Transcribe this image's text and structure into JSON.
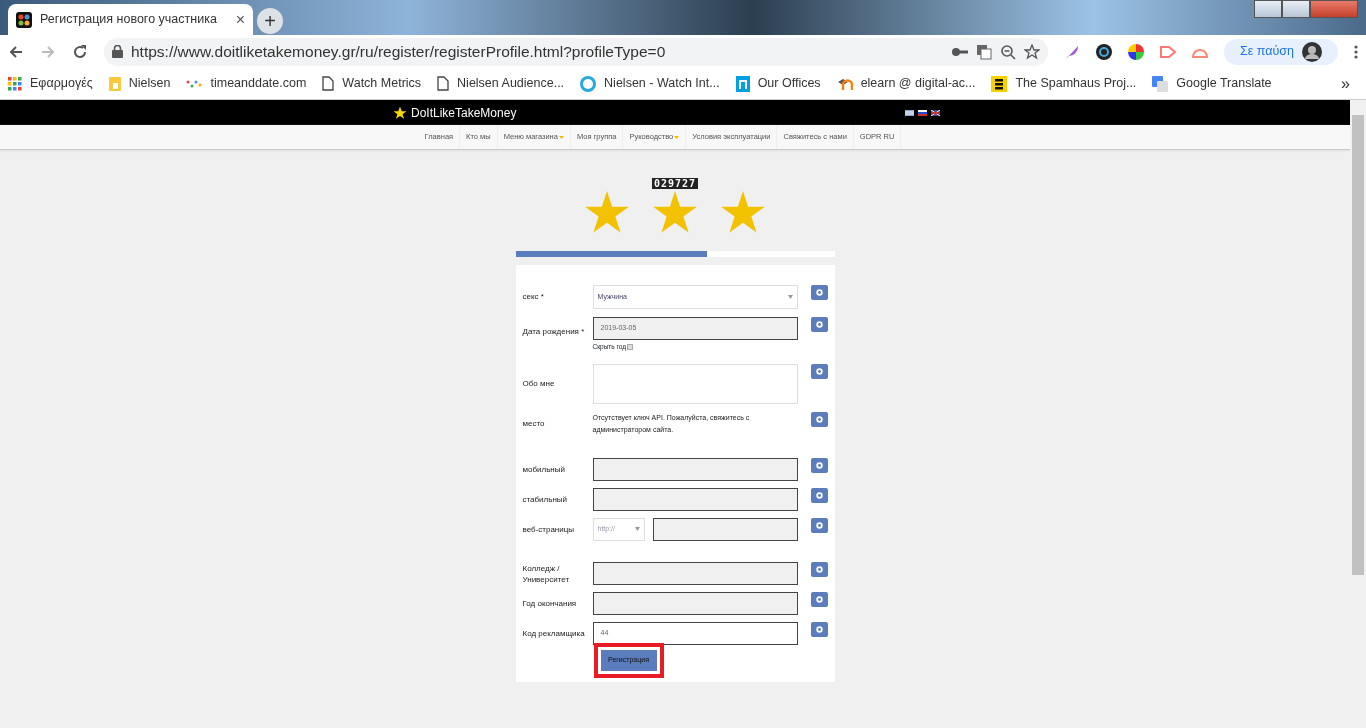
{
  "browser": {
    "tab": {
      "title": "Регистрация нового участника",
      "close": "×"
    },
    "new_tab": "+",
    "url": "https://www.doitliketakemoney.gr/ru/register/registerProfile.html?profileType=0",
    "profile": "Σε παύση",
    "bookmarks": [
      {
        "label": "Εφαρμογές",
        "kind": "apps"
      },
      {
        "label": "Nielsen",
        "kind": "folder"
      },
      {
        "label": "timeanddate.com",
        "kind": "dots"
      },
      {
        "label": "Watch Metrics",
        "kind": "page"
      },
      {
        "label": "Nielsen Audience...",
        "kind": "page"
      },
      {
        "label": "Nielsen - Watch Int...",
        "kind": "circle"
      },
      {
        "label": "Our Offices",
        "kind": "n"
      },
      {
        "label": "elearn @ digital-ac...",
        "kind": "hat"
      },
      {
        "label": "The Spamhaus Proj...",
        "kind": "s"
      },
      {
        "label": "Google Translate",
        "kind": "translate"
      }
    ],
    "more": "»"
  },
  "site": {
    "brand": "DoItLikeTakeMoney",
    "nav": [
      {
        "label": "Главная",
        "dropdown": false
      },
      {
        "label": "Кто мы",
        "dropdown": false
      },
      {
        "label": "Меню магазина",
        "dropdown": true
      },
      {
        "label": "Моя группа",
        "dropdown": false
      },
      {
        "label": "Руководство",
        "dropdown": true
      },
      {
        "label": "Условия эксплуатации",
        "dropdown": false
      },
      {
        "label": "Свяжитесь с нами",
        "dropdown": false
      },
      {
        "label": "GDPR RU",
        "dropdown": false
      }
    ],
    "counter": "029727",
    "stars": 3,
    "progress": {
      "level": 0.6
    },
    "form": {
      "rows": [
        {
          "kind": "select",
          "label": "секс *",
          "value": "Мужчина"
        },
        {
          "kind": "date",
          "label": "Дата рождения *",
          "value": "2019-03-05",
          "option": {
            "label": "Скрыть год",
            "checked": false
          }
        },
        {
          "kind": "textarea",
          "label": "Обо мне"
        },
        {
          "kind": "message",
          "label": "место",
          "text": "Отсутствует ключ API. Пожалуйста, свяжитесь с администратором сайта."
        },
        {
          "kind": "text",
          "label": "мобильный"
        },
        {
          "kind": "text",
          "label": "стабильный"
        },
        {
          "kind": "url",
          "label": "веб-страницы",
          "scheme": "http://"
        },
        {
          "kind": "text",
          "label": "Колледж / Университет"
        },
        {
          "kind": "text",
          "label": "Год окончания"
        },
        {
          "kind": "plain",
          "label": "Код рекламщика",
          "value": "44"
        }
      ],
      "submit": {
        "label": "Регистрация",
        "highlighted": true
      }
    }
  }
}
